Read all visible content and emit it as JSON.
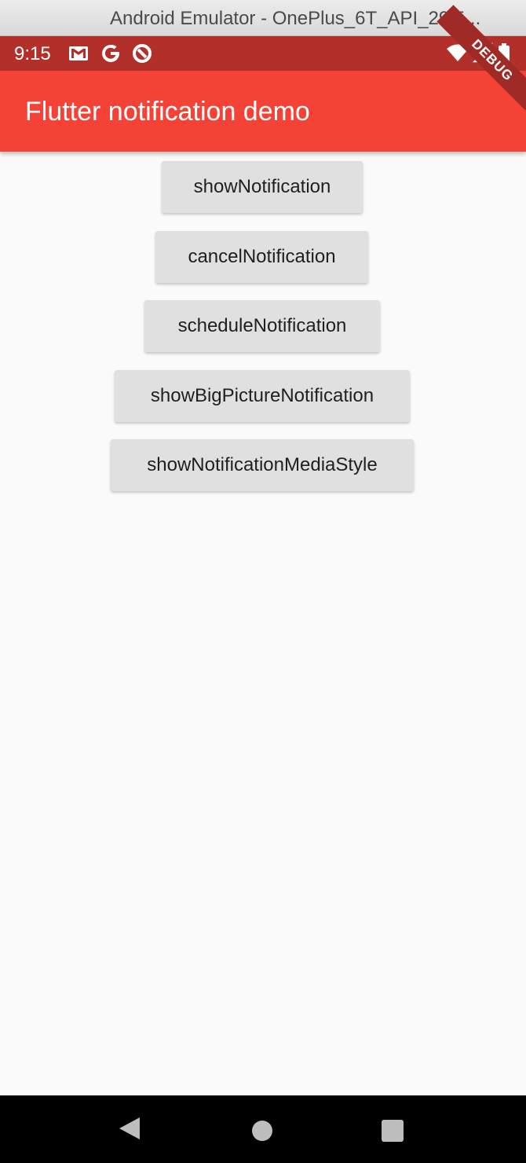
{
  "window": {
    "title": "Android Emulator - OnePlus_6T_API_29:5..."
  },
  "status_bar": {
    "time": "9:15",
    "left_icons": [
      "gmail-icon",
      "google-icon",
      "data-saver-icon"
    ],
    "right_icons": [
      "wifi-icon",
      "cell-signal-icon",
      "battery-icon"
    ],
    "color": "#b3302a"
  },
  "app_bar": {
    "title": "Flutter notification demo",
    "color": "#f44336",
    "debug_banner": "DEBUG"
  },
  "buttons": [
    {
      "label": "showNotification"
    },
    {
      "label": "cancelNotification"
    },
    {
      "label": "scheduleNotification"
    },
    {
      "label": "showBigPictureNotification"
    },
    {
      "label": "showNotificationMediaStyle"
    }
  ],
  "nav_bar": {
    "items": [
      "back-icon",
      "home-icon",
      "recents-icon"
    ]
  }
}
